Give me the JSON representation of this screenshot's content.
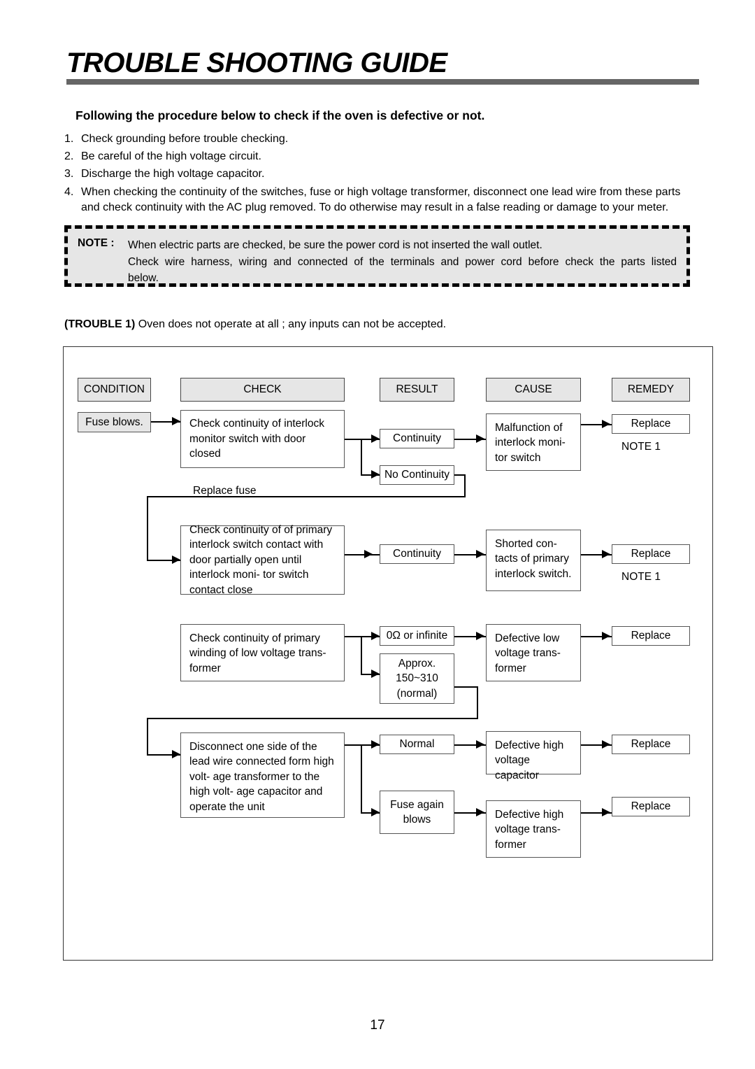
{
  "header": {
    "title": "TROUBLE SHOOTING GUIDE"
  },
  "intro": {
    "lead": "Following the procedure below to check if the oven is defective or not.",
    "steps": [
      {
        "num": "1.",
        "text": "Check grounding before trouble checking."
      },
      {
        "num": "2.",
        "text": "Be careful of the high voltage circuit."
      },
      {
        "num": "3.",
        "text": "Discharge the high voltage capacitor."
      },
      {
        "num": "4.",
        "text": "When checking the continuity of the switches, fuse or high voltage transformer, disconnect one lead wire from these parts and check continuity with the AC plug removed. To do otherwise may result in a false reading or damage to your meter."
      }
    ]
  },
  "note": {
    "label": "NOTE :",
    "line1": "When electric parts are checked, be sure the power cord is not inserted the wall outlet.",
    "line2": "Check wire harness, wiring and connected of the terminals and power cord before check the parts listed",
    "line3": "below."
  },
  "trouble": {
    "tag": "(TROUBLE 1)",
    "text": "Oven does not operate at all ; any inputs can not be accepted."
  },
  "flowchart": {
    "columns": {
      "condition": "CONDITION",
      "check": "CHECK",
      "result": "RESULT",
      "cause": "CAUSE",
      "remedy": "REMEDY"
    },
    "condition": "Fuse blows.",
    "loop_label": "Replace fuse",
    "rows": [
      {
        "check": "Check continuity of interlock monitor switch with door closed",
        "results": [
          "Continuity",
          "No Continuity"
        ],
        "cause": "Malfunction of interlock moni- tor switch",
        "remedy": "Replace",
        "remedy_note": "NOTE 1"
      },
      {
        "check": "Check continuity of of primary interlock switch contact with door partially open until interlock moni- tor switch contact close",
        "results": [
          "Continuity"
        ],
        "cause": "Shorted con- tacts of primary interlock switch.",
        "remedy": "Replace",
        "remedy_note": "NOTE 1"
      },
      {
        "check": "Check continuity of primary winding of low voltage trans- former",
        "results": [
          "0Ω or infinite",
          "Approx. 150~310 (normal)"
        ],
        "cause": "Defective low voltage trans- former",
        "remedy": "Replace",
        "remedy_note": ""
      },
      {
        "check": "Disconnect one side of the lead wire connected form high volt- age transformer to the high volt- age capacitor and operate the unit",
        "results": [
          "Normal",
          "Fuse again blows"
        ],
        "cause": "Defective high voltage capacitor",
        "cause2": "Defective high voltage trans- former",
        "remedy": "Replace",
        "remedy2": "Replace",
        "remedy_note": ""
      }
    ]
  },
  "footer": {
    "page_number": "17"
  }
}
